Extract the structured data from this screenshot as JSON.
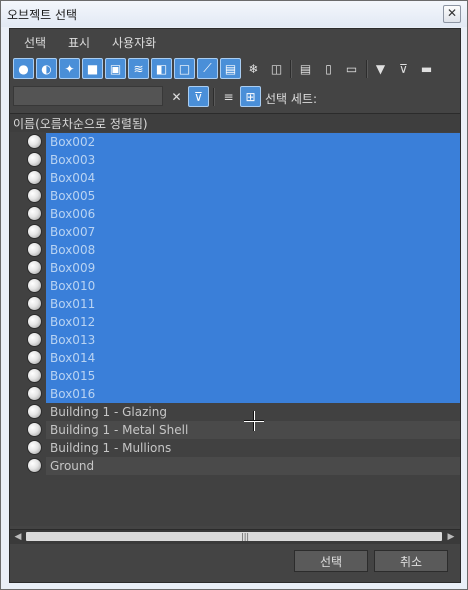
{
  "window": {
    "title": "오브젝트 선택",
    "close_glyph": "✕"
  },
  "menu": {
    "items": [
      "선택",
      "표시",
      "사용자화"
    ]
  },
  "toolbar": {
    "filter_icons": [
      "geometry-icon",
      "shapes-icon",
      "lights-icon",
      "cameras-icon",
      "helpers-icon",
      "space-warps-icon",
      "groups-icon",
      "xrefs-icon",
      "bones-icon",
      "containers-icon",
      "frozen-icon",
      "hidden-icon"
    ],
    "list_icons": [
      "list-all-icon",
      "list-none-icon",
      "list-invert-icon"
    ],
    "filter_tools": [
      "filter-icon",
      "filter-options-icon",
      "filter-extra-icon"
    ]
  },
  "search": {
    "value": ""
  },
  "selection_set": {
    "label": "선택 세트:"
  },
  "column": {
    "header": "이름(오름차순으로 정렬됨)"
  },
  "objects": [
    {
      "name": "Box002",
      "selected": true
    },
    {
      "name": "Box003",
      "selected": true
    },
    {
      "name": "Box004",
      "selected": true
    },
    {
      "name": "Box005",
      "selected": true
    },
    {
      "name": "Box006",
      "selected": true
    },
    {
      "name": "Box007",
      "selected": true
    },
    {
      "name": "Box008",
      "selected": true
    },
    {
      "name": "Box009",
      "selected": true
    },
    {
      "name": "Box010",
      "selected": true
    },
    {
      "name": "Box011",
      "selected": true
    },
    {
      "name": "Box012",
      "selected": true
    },
    {
      "name": "Box013",
      "selected": true
    },
    {
      "name": "Box014",
      "selected": true
    },
    {
      "name": "Box015",
      "selected": true
    },
    {
      "name": "Box016",
      "selected": true
    },
    {
      "name": "Building 1 - Glazing",
      "selected": false
    },
    {
      "name": "Building 1 - Metal Shell",
      "selected": false
    },
    {
      "name": "Building 1 - Mullions",
      "selected": false
    },
    {
      "name": "Ground",
      "selected": false
    }
  ],
  "buttons": {
    "ok": "선택",
    "cancel": "취소"
  },
  "colors": {
    "selection": "#3a7fd9",
    "panel": "#444444",
    "accent_on": "#4a8fd8"
  }
}
